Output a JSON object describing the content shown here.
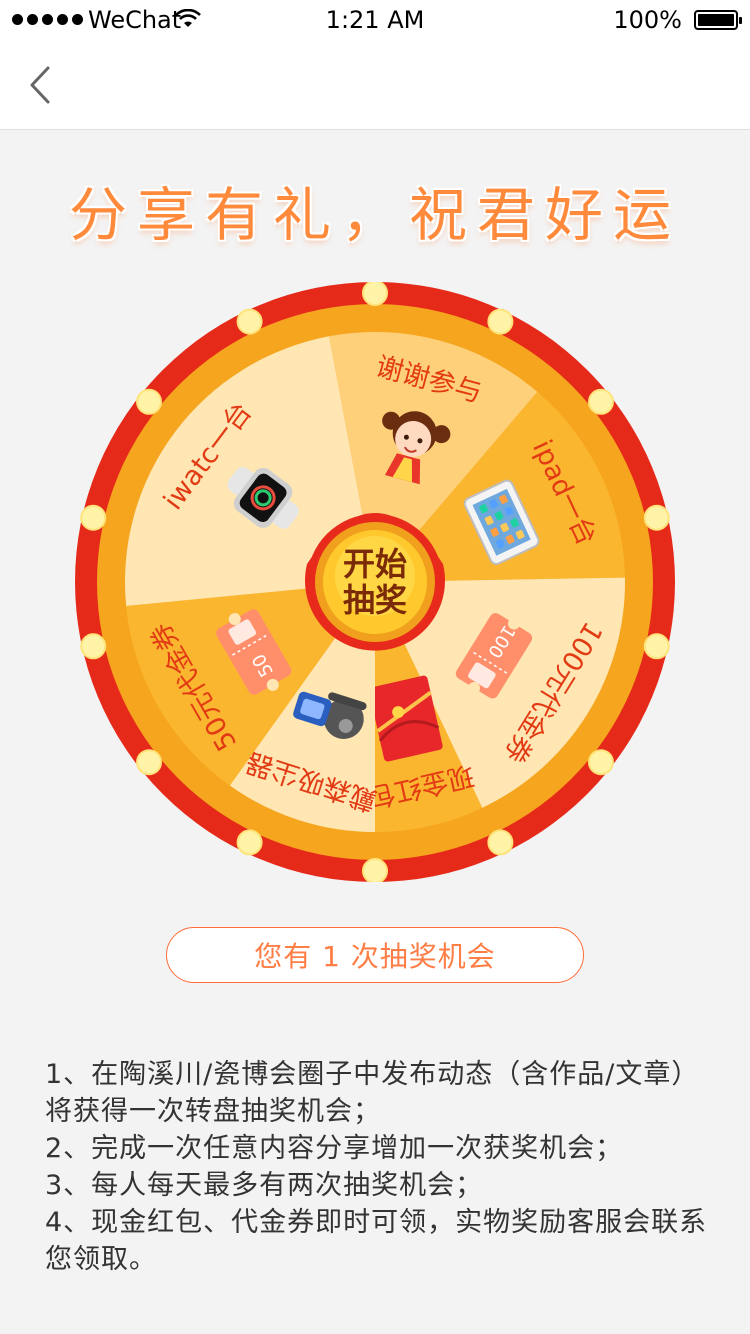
{
  "status_bar": {
    "carrier": "WeChat",
    "time": "1:21 AM",
    "battery": "100%"
  },
  "nav": {
    "back_icon": "chevron-left-icon"
  },
  "headline": "分享有礼，祝君好运",
  "wheel": {
    "start_label": "开始抽奖",
    "prizes": [
      {
        "label": "谢谢参与",
        "icon": "mascot-girl-icon"
      },
      {
        "label": "ipad一台",
        "icon": "ipad-icon"
      },
      {
        "label": "100元代金券",
        "icon": "coupon-icon",
        "coupon_value": "100"
      },
      {
        "label": "现金红包",
        "icon": "red-envelope-icon"
      },
      {
        "label": "戴森吸尘器",
        "icon": "vacuum-cleaner-icon"
      },
      {
        "label": "50元代金券",
        "icon": "coupon-icon",
        "coupon_value": "50"
      },
      {
        "label": "iwatc一台",
        "icon": "smartwatch-icon"
      }
    ],
    "colors": {
      "rim": "#e62a1a",
      "inner_ring": "#f6a51f",
      "segment_light": "#ffe6b3",
      "segment_mid": "#ffd07a",
      "segment_dark": "#fbb630",
      "label": "#e23b14",
      "bulb": "#fff3a8"
    }
  },
  "chance_text": "您有 1 次抽奖机会",
  "rules": [
    "1、在陶溪川/瓷博会圈子中发布动态（含作品/文章）将获得一次转盘抽奖机会；",
    "2、完成一次任意内容分享增加一次获奖机会；",
    "3、每人每天最多有两次抽奖机会；",
    "4、现金红包、代金券即时可领，实物奖励客服会联系您领取。"
  ]
}
